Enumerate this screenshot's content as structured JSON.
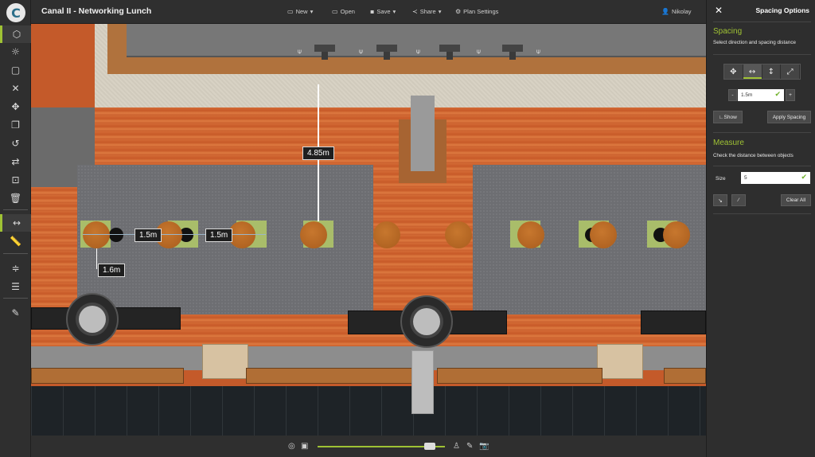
{
  "app": {
    "logo": "C",
    "title": "Canal II - Networking Lunch"
  },
  "menu": [
    {
      "label": "New",
      "caret": "▾",
      "icon": "file-icon"
    },
    {
      "label": "Open",
      "icon": "folder-icon"
    },
    {
      "label": "Save",
      "caret": "▾",
      "icon": "save-icon"
    },
    {
      "label": "Share",
      "caret": "▾",
      "icon": "share-icon"
    },
    {
      "label": "Plan Settings",
      "icon": "gear-icon"
    },
    {
      "label": "Nikolay",
      "icon": "user-icon"
    }
  ],
  "panel": {
    "title": "Spacing Options",
    "spacing": {
      "title": "Spacing",
      "desc": "Select direction and spacing distance",
      "directions": [
        "✥",
        "↔",
        "↕",
        "⤢"
      ],
      "minus": "-",
      "plus": "+",
      "value": "1.5m",
      "show": "Show",
      "apply": "Apply Spacing"
    },
    "measure": {
      "title": "Measure",
      "desc": "Check the distance between objects",
      "size_label": "Size",
      "size_value": "5",
      "clear": "Clear All"
    }
  },
  "measurements": {
    "vertical": "4.85m",
    "h1": "1.5m",
    "h2": "1.5m",
    "diag": "1.6m"
  },
  "colors": {
    "accent": "#9fc234",
    "panel": "#2e2e2e",
    "floor": "#c85e2c"
  }
}
